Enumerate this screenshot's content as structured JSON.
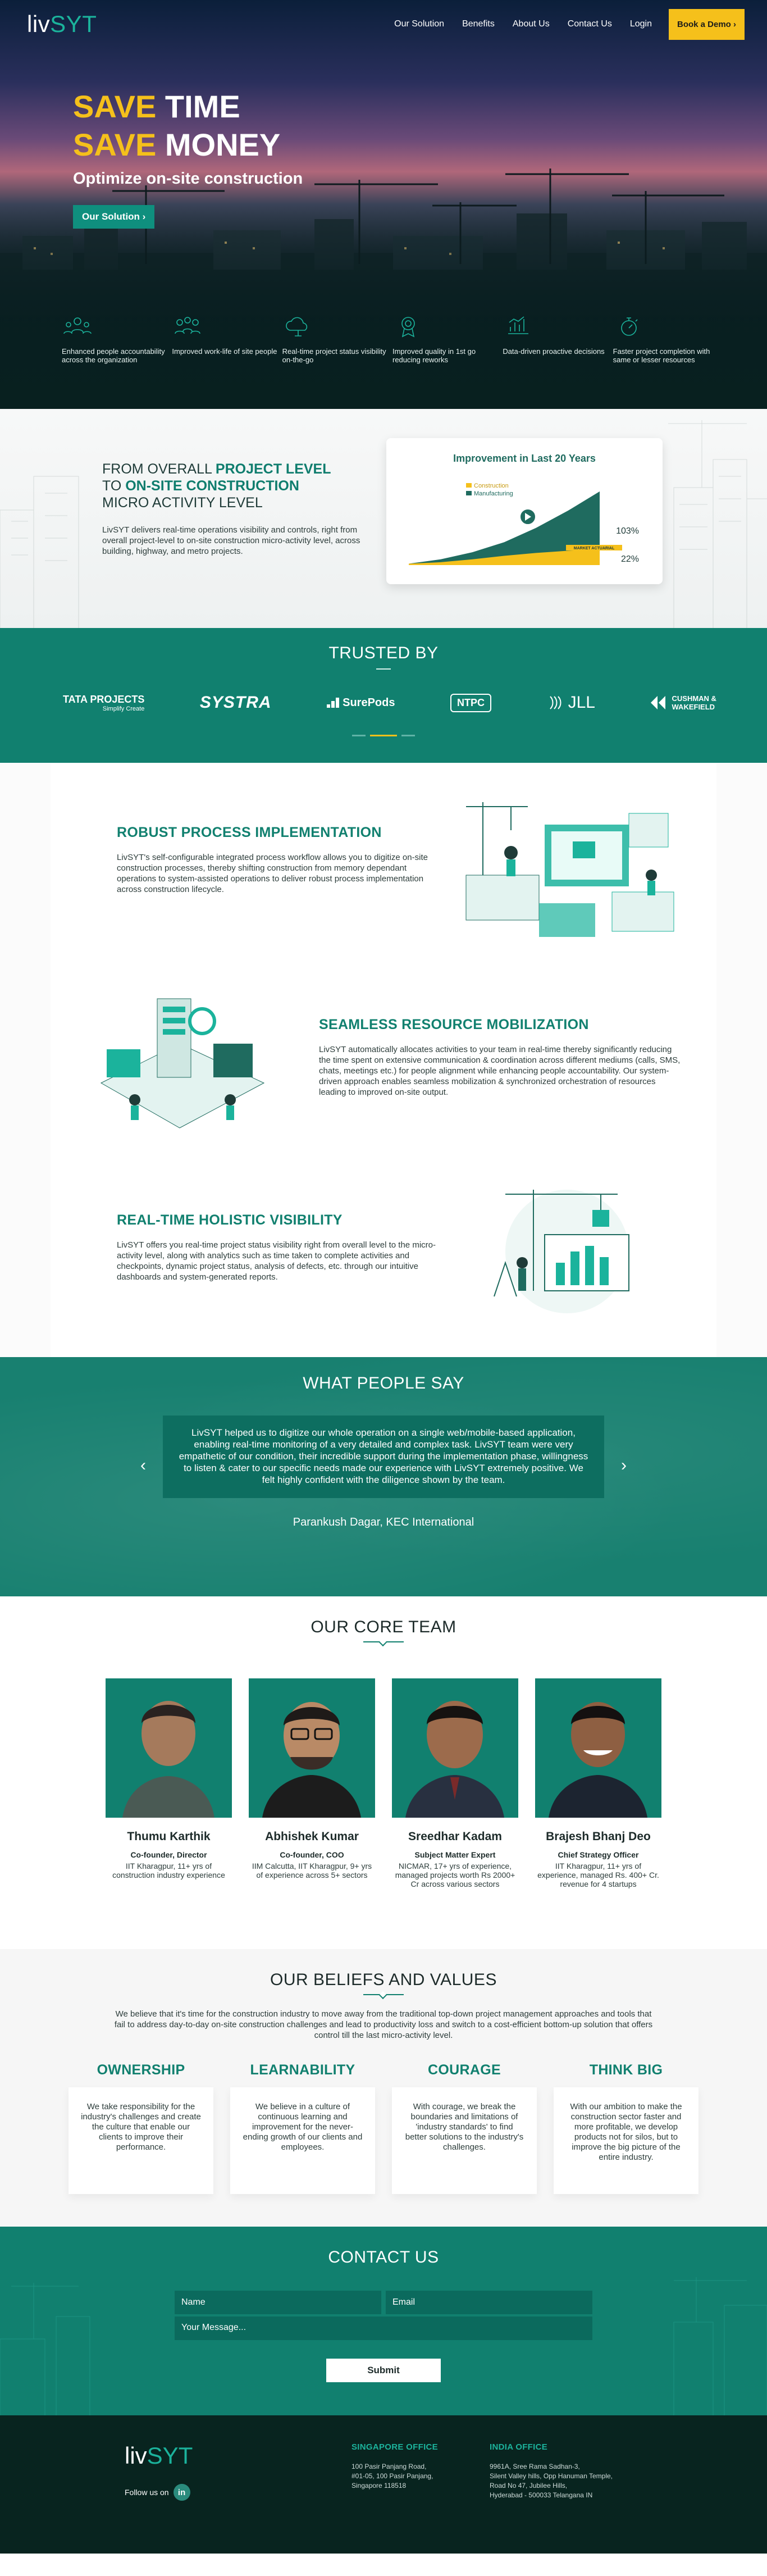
{
  "nav": {
    "logo_main": "liv",
    "logo_accent": "SYT",
    "links": [
      "Our Solution",
      "Benefits",
      "About Us",
      "Contact Us",
      "Login"
    ],
    "cta": "Book a Demo ›"
  },
  "hero": {
    "line1_accent": "SAVE",
    "line1_rest": " TIME",
    "line2_accent": "SAVE",
    "line2_rest": " MONEY",
    "subtitle": "Optimize on-site construction",
    "button": "Our Solution  ›",
    "features": [
      {
        "icon": "people-accountability-icon",
        "text": "Enhanced people accountability across the organization"
      },
      {
        "icon": "work-life-icon",
        "text": "Improved work-life of site people"
      },
      {
        "icon": "cloud-status-icon",
        "text": "Real-time project status visibility on-the-go"
      },
      {
        "icon": "quality-badge-icon",
        "text": "Improved quality in 1st go reducing reworks"
      },
      {
        "icon": "data-decisions-icon",
        "text": "Data-driven proactive decisions"
      },
      {
        "icon": "stopwatch-icon",
        "text": "Faster project completion with same or lesser resources"
      }
    ]
  },
  "improve": {
    "line1_plain": "FROM OVERALL ",
    "line1_bold": "PROJECT LEVEL",
    "line2_plain": "TO ",
    "line2_bold": "ON-SITE CONSTRUCTION",
    "line3": "MICRO ACTIVITY LEVEL",
    "paragraph": "LivSYT delivers real-time operations visibility and controls, right from overall project-level to on-site construction micro-activity level, across building, highway, and metro projects."
  },
  "chart_data": {
    "type": "area",
    "title": "Improvement in Last 20 Years",
    "series": [
      {
        "name": "Construction",
        "values": [
          2,
          4,
          8,
          13,
          17,
          20,
          22
        ]
      },
      {
        "name": "Manufacturing",
        "values": [
          2,
          8,
          18,
          32,
          52,
          76,
          103
        ]
      }
    ],
    "annotations": [
      "103%",
      "22%",
      "MARKET ACTUARIAL"
    ],
    "colors": {
      "construction": "#f5c01b",
      "manufacturing": "#1f6b5f"
    }
  },
  "trusted": {
    "title": "TRUSTED BY",
    "logos": [
      {
        "name": "TATA PROJECTS",
        "tagline": "Simplify Create"
      },
      {
        "name": "SYSTRA"
      },
      {
        "name": "SurePods"
      },
      {
        "name": "NTPC"
      },
      {
        "name": "JLL"
      },
      {
        "name": "CUSHMAN &",
        "tagline": "WAKEFIELD"
      }
    ]
  },
  "process": {
    "blocks": [
      {
        "title": "ROBUST PROCESS IMPLEMENTATION",
        "text": "LivSYT's self-configurable integrated process workflow allows you to digitize on-site construction processes, thereby shifting construction from memory dependant operations to system-assisted operations to deliver robust process implementation across construction lifecycle."
      },
      {
        "title": "SEAMLESS RESOURCE MOBILIZATION",
        "text": "LivSYT automatically allocates activities to your team in real-time thereby significantly reducing the time spent on extensive communication & coordination across different mediums (calls, SMS, chats, meetings etc.) for people alignment while enhancing people accountability. Our system-driven approach enables seamless mobilization & synchronized orchestration of resources leading to improved on-site output."
      },
      {
        "title": "REAL-TIME HOLISTIC VISIBILITY",
        "text": "LivSYT offers you real-time project status visibility right from overall level to the micro-activity level, along with analytics such as time taken to complete activities and checkpoints, dynamic project status, analysis of defects, etc. through our intuitive dashboards and system-generated reports."
      }
    ]
  },
  "testimonial": {
    "title": "WHAT PEOPLE SAY",
    "quote": "LivSYT helped us to digitize our whole operation on a single web/mobile-based application, enabling real-time monitoring of a very detailed and complex task. LivSYT team were very empathetic of our condition, their incredible support during the implementation phase, willingness to listen & cater to our specific needs made our experience with LivSYT extremely positive. We felt highly confident with the diligence shown by the team.",
    "author": "Parankush Dagar, KEC International",
    "prev": "‹",
    "next": "›"
  },
  "team": {
    "title": "OUR CORE TEAM",
    "members": [
      {
        "name": "Thumu Karthik",
        "role": "Co-founder, Director",
        "desc": "IIT Kharagpur, 11+ yrs of construction industry experience"
      },
      {
        "name": "Abhishek Kumar",
        "role": "Co-founder, COO",
        "desc": "IIM Calcutta, IIT Kharagpur, 9+ yrs of experience across 5+ sectors"
      },
      {
        "name": "Sreedhar Kadam",
        "role": "Subject Matter Expert",
        "desc": "NICMAR, 17+ yrs of experience, managed projects worth Rs 2000+ Cr across various sectors"
      },
      {
        "name": "Brajesh Bhanj Deo",
        "role": "Chief Strategy Officer",
        "desc": "IIT Kharagpur, 11+ yrs of experience, managed Rs. 400+ Cr. revenue for 4 startups"
      }
    ]
  },
  "beliefs": {
    "title": "OUR BELIEFS AND VALUES",
    "intro": "We believe that it's time for the construction industry to move away from the traditional top-down project management approaches and tools that fail to address day-to-day on-site construction challenges and lead to productivity loss and switch to a cost-efficient bottom-up solution that offers control till the last micro-activity level.",
    "values": [
      {
        "title": "OWNERSHIP",
        "text": "We take responsibility for the industry's challenges and create the culture that enable our clients to improve their performance."
      },
      {
        "title": "LEARNABILITY",
        "text": "We believe in a culture of continuous learning and improvement for the never-ending growth of our clients and employees."
      },
      {
        "title": "COURAGE",
        "text": "With courage, we break the boundaries and limitations of 'industry standards' to find better solutions to the industry's challenges."
      },
      {
        "title": "THINK BIG",
        "text": "With our ambition to make the construction sector faster and more profitable, we develop products not for silos, but to improve the big picture of the entire industry."
      }
    ]
  },
  "contact": {
    "title": "CONTACT US",
    "name_placeholder": "Name",
    "email_placeholder": "Email",
    "message_placeholder": "Your Message...",
    "submit": "Submit"
  },
  "footer": {
    "follow": "Follow us on",
    "linkedin": "in",
    "offices": [
      {
        "title": "SINGAPORE OFFICE",
        "lines": [
          "100 Pasir Panjang Road,",
          "#01-05, 100 Pasir Panjang,",
          "Singapore 118518"
        ]
      },
      {
        "title": "INDIA OFFICE",
        "lines": [
          "9961A, Sree Rama Sadhan-3,",
          "Silent Valley hills, Opp Hanuman Temple,",
          "Road No 47, Jubilee Hills,",
          "Hyderabad - 500033 Telangana IN"
        ]
      }
    ]
  }
}
